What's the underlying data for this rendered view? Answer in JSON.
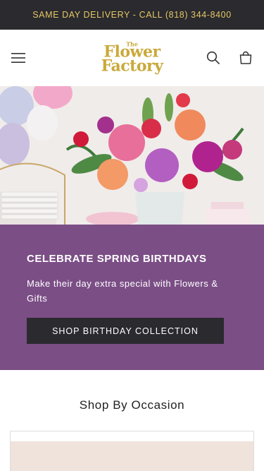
{
  "announcement": {
    "text": "SAME DAY DELIVERY - CALL (818) 344-8400"
  },
  "header": {
    "logo": {
      "the": "The",
      "line1": "Flower",
      "line2": "Factory"
    },
    "menu_icon": "hamburger-menu-icon",
    "search_icon": "search-icon",
    "cart_icon": "shopping-bag-icon"
  },
  "hero": {
    "image": "vase of spring flowers beside balloons and plates"
  },
  "promo": {
    "heading": "CELEBRATE SPRING BIRTHDAYS",
    "description": "Make their day extra special with Flowers & Gifts",
    "button_label": "SHOP BIRTHDAY COLLECTION",
    "background_color": "#7b4e86"
  },
  "occasion": {
    "heading": "Shop By Occasion"
  },
  "colors": {
    "announcement_bg": "#2a2a2f",
    "announcement_text": "#e6c766",
    "logo": "#c9a93a"
  }
}
